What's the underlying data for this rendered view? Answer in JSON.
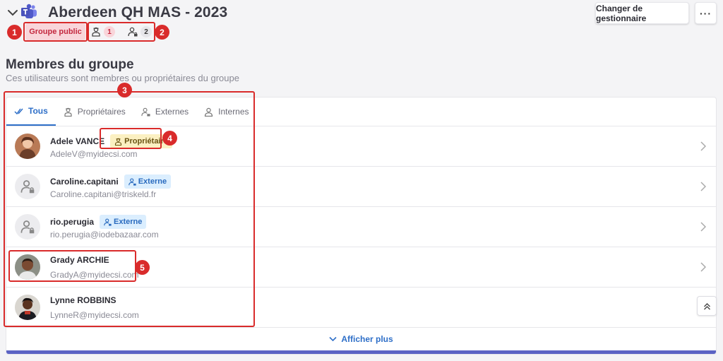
{
  "header": {
    "title": "Aberdeen QH MAS - 2023",
    "visibility_badge": "Groupe public",
    "owners_count": "1",
    "externals_count": "2",
    "manager_button": "Changer de gestionnaire",
    "more_button": "···"
  },
  "section": {
    "title": "Membres du groupe",
    "subtitle": "Ces utilisateurs sont membres ou propriétaires du groupe"
  },
  "tabs": [
    {
      "label": "Tous",
      "active": true
    },
    {
      "label": "Propriétaires",
      "active": false
    },
    {
      "label": "Externes",
      "active": false
    },
    {
      "label": "Internes",
      "active": false
    }
  ],
  "members": [
    {
      "name": "Adele VANCE",
      "email": "AdeleV@myidecsi.com",
      "tag": "Propriétaire",
      "avatar": "photo"
    },
    {
      "name": "Caroline.capitani",
      "email": "Caroline.capitani@triskeld.fr",
      "tag": "Externe",
      "avatar": "external-user-icon"
    },
    {
      "name": "rio.perugia",
      "email": "rio.perugia@iodebazaar.com",
      "tag": "Externe",
      "avatar": "external-user-icon"
    },
    {
      "name": "Grady ARCHIE",
      "email": "GradyA@myidecsi.com",
      "tag": "",
      "avatar": "photo"
    },
    {
      "name": "Lynne ROBBINS",
      "email": "LynneR@myidecsi.com",
      "tag": "",
      "avatar": "photo"
    }
  ],
  "show_more": "Afficher plus",
  "annotations": [
    "1",
    "2",
    "3",
    "4",
    "5"
  ],
  "colors": {
    "accent": "#2e6fc8",
    "annotation": "#d92b2b",
    "public_badge_bg": "#f9d5da",
    "owner_tag_bg": "#fbf0c2",
    "external_tag_bg": "#dbeefe",
    "card_bottom": "#5b63c4"
  }
}
